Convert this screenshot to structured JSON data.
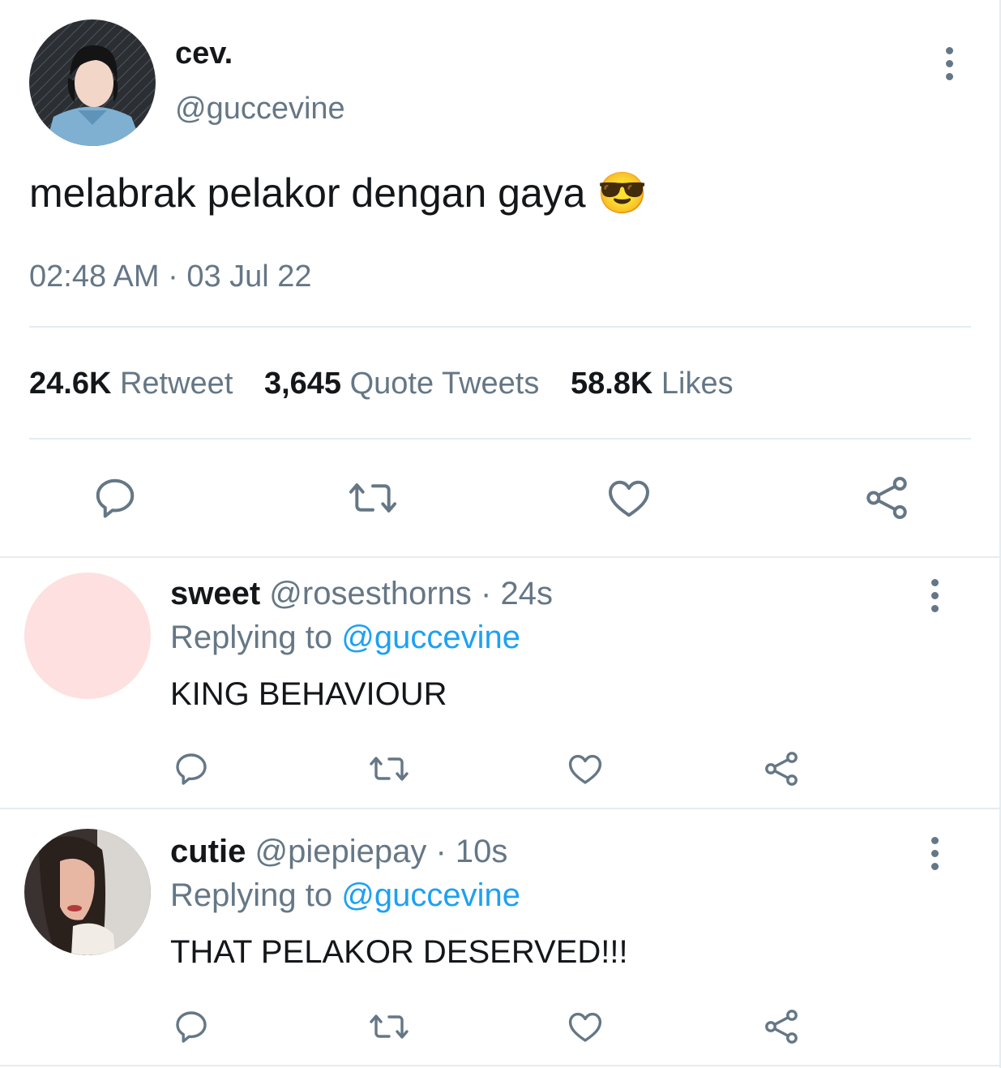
{
  "tweet": {
    "display_name": "cev.",
    "handle": "@guccevine",
    "text": "melabrak pelakor dengan gaya",
    "emoji": "😎",
    "timestamp": "02:48 AM · 03 Jul 22",
    "stats": {
      "retweets_count": "24.6K",
      "retweets_label": "Retweet",
      "quotes_count": "3,645",
      "quotes_label": "Quote Tweets",
      "likes_count": "58.8K",
      "likes_label": "Likes"
    }
  },
  "replies": [
    {
      "display_name": "sweet",
      "handle": "@rosesthorns",
      "time": "· 24s",
      "replying_prefix": "Replying to",
      "replying_to": "@guccevine",
      "text": "KING BEHAVIOUR"
    },
    {
      "display_name": "cutie",
      "handle": "@piepiepay",
      "time": "· 10s",
      "replying_prefix": "Replying to",
      "replying_to": "@guccevine",
      "text": "THAT PELAKOR DESERVED!!!"
    }
  ],
  "icons": [
    "reply-icon",
    "retweet-icon",
    "like-icon",
    "share-icon",
    "more-icon"
  ],
  "colors": {
    "text": "#14171a",
    "muted": "#657786",
    "link": "#1da1f2",
    "divider": "#e6ecf0",
    "reply1_avatar": "#fde0df"
  }
}
